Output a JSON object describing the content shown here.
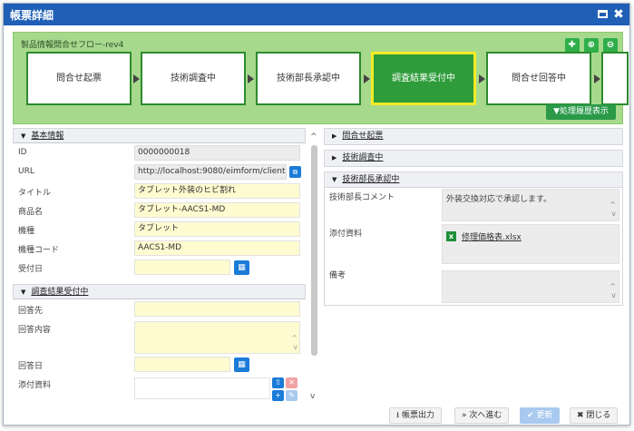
{
  "window": {
    "title": "帳票詳細",
    "maximize_icon": "maximize-icon",
    "close_glyph": "✖"
  },
  "flow": {
    "name": "製品情報問合せフロー-rev4",
    "tools": [
      {
        "name": "move-icon",
        "glyph": "✚"
      },
      {
        "name": "zoom-in-icon",
        "glyph": "⊕"
      },
      {
        "name": "zoom-out-icon",
        "glyph": "⊖"
      }
    ],
    "steps": [
      "問合せ起票",
      "技術調査中",
      "技術部長承認中",
      "調査結果受付中",
      "問合せ回答中"
    ],
    "active_step": "調査結果受付中",
    "history_button": "▼処理履歴表示"
  },
  "basic": {
    "header": "基本情報",
    "fields": {
      "id": {
        "label": "ID",
        "value": "0000000018"
      },
      "url": {
        "label": "URL",
        "value": "http://localhost:9080/eimform/client"
      },
      "title": {
        "label": "タイトル",
        "value": "タブレット外装のヒビ割れ"
      },
      "product": {
        "label": "商品名",
        "value": "タブレット-AACS1-MD"
      },
      "model": {
        "label": "機種",
        "value": "タブレット"
      },
      "model_code": {
        "label": "機種コード",
        "value": "AACS1-MD"
      },
      "received_date": {
        "label": "受付日",
        "value": ""
      }
    }
  },
  "survey": {
    "header": "調査結果受付中",
    "fields": {
      "recipient": {
        "label": "回答先",
        "value": ""
      },
      "content": {
        "label": "回答内容",
        "value": ""
      },
      "answer_date": {
        "label": "回答日",
        "value": ""
      },
      "attachments": {
        "label": "添付資料"
      }
    }
  },
  "right": {
    "sections": [
      {
        "header": "問合せ起票"
      },
      {
        "header": "技術調査中"
      }
    ],
    "approval": {
      "header": "技術部長承認中",
      "comment_label": "技術部長コメント",
      "comment": "外装交換対応で承認します。",
      "attach_label": "添付資料",
      "attach_file": "修理価格表.xlsx",
      "remarks_label": "備考",
      "remarks": ""
    }
  },
  "footer": {
    "print": "帳票出力",
    "next": "次へ進む",
    "update": "更新",
    "close": "閉じる"
  },
  "colors": {
    "titlebar": "#1f5fb6",
    "flow_bg": "#a6d98c",
    "active_step": "#2e9c3a",
    "active_border": "#f6ea25",
    "input_bg": "#fffbd0"
  }
}
